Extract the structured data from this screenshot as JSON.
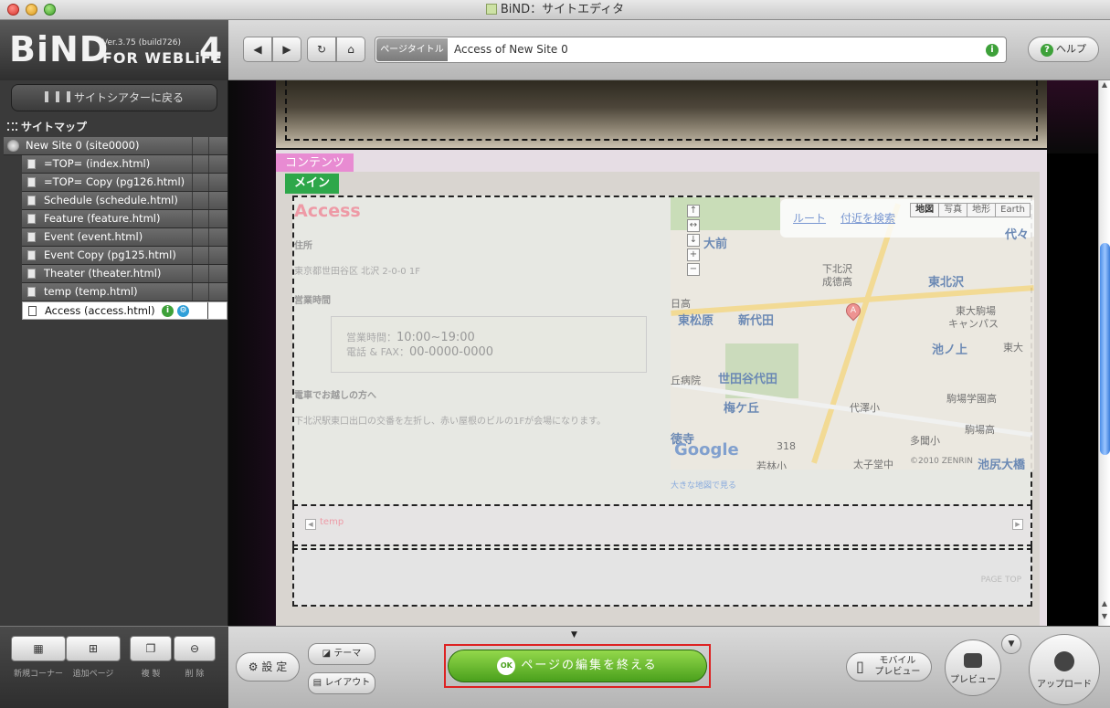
{
  "window": {
    "title": "BiND：サイトエディタ"
  },
  "logo": {
    "brand": "BiND",
    "version": "Ver.3.75 (build726)",
    "for": "FOR WEBLiFE",
    "num": "4"
  },
  "toolbar": {
    "back": "◀",
    "forward": "▶",
    "reload": "↻",
    "home": "⌂",
    "page_title_label": "ページタイトル",
    "page_title_value": "Access of New Site 0",
    "help_label": "ヘルプ"
  },
  "sidebar": {
    "back_label": "サイトシアターに戻る",
    "sitemap_label": "サイトマップ",
    "root": "New Site 0 (site0000)",
    "pages": [
      "=TOP= (index.html)",
      "=TOP= Copy (pg126.html)",
      "Schedule (schedule.html)",
      "Feature (feature.html)",
      "Event (event.html)",
      "Event Copy (pg125.html)",
      "Theater (theater.html)",
      "temp (temp.html)",
      "Access (access.html)"
    ],
    "selected_index": 8
  },
  "page": {
    "contents_tab": "コンテンツ",
    "main_tab": "メイン",
    "heading": "Access",
    "address_label": "住所",
    "address": "東京都世田谷区 北沢 2-0-0 1F",
    "hours_label": "営業時間",
    "hours_line1_prefix": "営業時間：",
    "hours_line1_value": "10:00~19:00",
    "hours_line2_prefix": "電話 & FAX：",
    "hours_line2_value": "00-0000-0000",
    "train_label": "電車でお越しの方へ",
    "train_text": "下北沢駅東口出口の交番を左折し、赤い屋根のビルの1Fが会場になります。",
    "map": {
      "tabs": [
        "地図",
        "写真",
        "地形",
        "Earth"
      ],
      "route": "ルート",
      "nearby": "付近を検索",
      "labels": [
        "大前",
        "下北沢",
        "東北沢",
        "東松原",
        "新代田",
        "池ノ上",
        "世田谷代田",
        "梅ケ丘",
        "代々",
        "成德高",
        "東大駒場",
        "キャンパス",
        "代澤小",
        "駒場学園高",
        "駒場高",
        "多聞小",
        "若林小",
        "池尻大橋",
        "東大",
        "丘病院",
        "徳寺",
        "日高",
        "太子堂中"
      ],
      "google": "Google",
      "copyright": "©2010 ZENRIN",
      "pin": "A",
      "road_num": "318"
    },
    "big_map_link": "大きな地図で見る",
    "temp_label": "temp",
    "page_top": "PAGE TOP"
  },
  "bottom": {
    "new_corner": "新規コーナー",
    "add_page": "追加ページ",
    "duplicate": "複 製",
    "delete": "削 除",
    "settings": "設 定",
    "theme": "テーマ",
    "layout": "レイアウト",
    "finish": "ページの編集を終える",
    "ok": "OK",
    "mobile_preview": "モバイル\nプレビュー",
    "mobile_preview_l1": "モバイル",
    "mobile_preview_l2": "プレビュー",
    "preview": "プレビュー",
    "upload": "アップロード"
  },
  "colors": {
    "accent_green": "#4aa01c",
    "contents_tab": "#e88bd2",
    "main_tab": "#2ea74a",
    "highlight": "#dd2222"
  }
}
